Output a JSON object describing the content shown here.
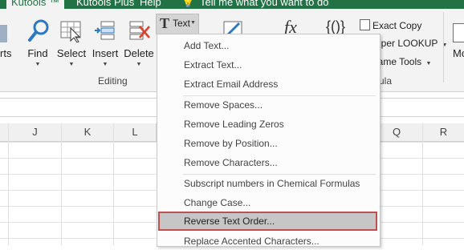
{
  "tabs": [
    "Kutools ™",
    "Kutools Plus",
    "Help",
    "Tell me what you want to do"
  ],
  "ribbon": {
    "left_partial": "rts",
    "find": "Find",
    "select": "Select",
    "insert": "Insert",
    "delete": "Delete",
    "text_button": "Text",
    "group_editing": "Editing",
    "exact_copy": "Exact Copy",
    "super_lookup": "uper LOOKUP",
    "name_tools": "lame Tools",
    "group_formula": "ula",
    "right_partial": "Mo",
    "fx_glyph": "fx",
    "braces_glyph": "{()}"
  },
  "columns": [
    "J",
    "K",
    "L",
    "Q",
    "R"
  ],
  "menu": {
    "items": [
      "Add Text...",
      "Extract Text...",
      "Extract Email Address",
      "Remove Spaces...",
      "Remove Leading Zeros",
      "Remove by Position...",
      "Remove Characters...",
      "Subscript numbers in Chemical Formulas",
      "Change Case...",
      "Reverse Text Order...",
      "Replace Accented Characters..."
    ],
    "highlighted": "Reverse Text Order..."
  },
  "colors": {
    "excel_green": "#217346",
    "highlight_border": "#c0504d"
  }
}
